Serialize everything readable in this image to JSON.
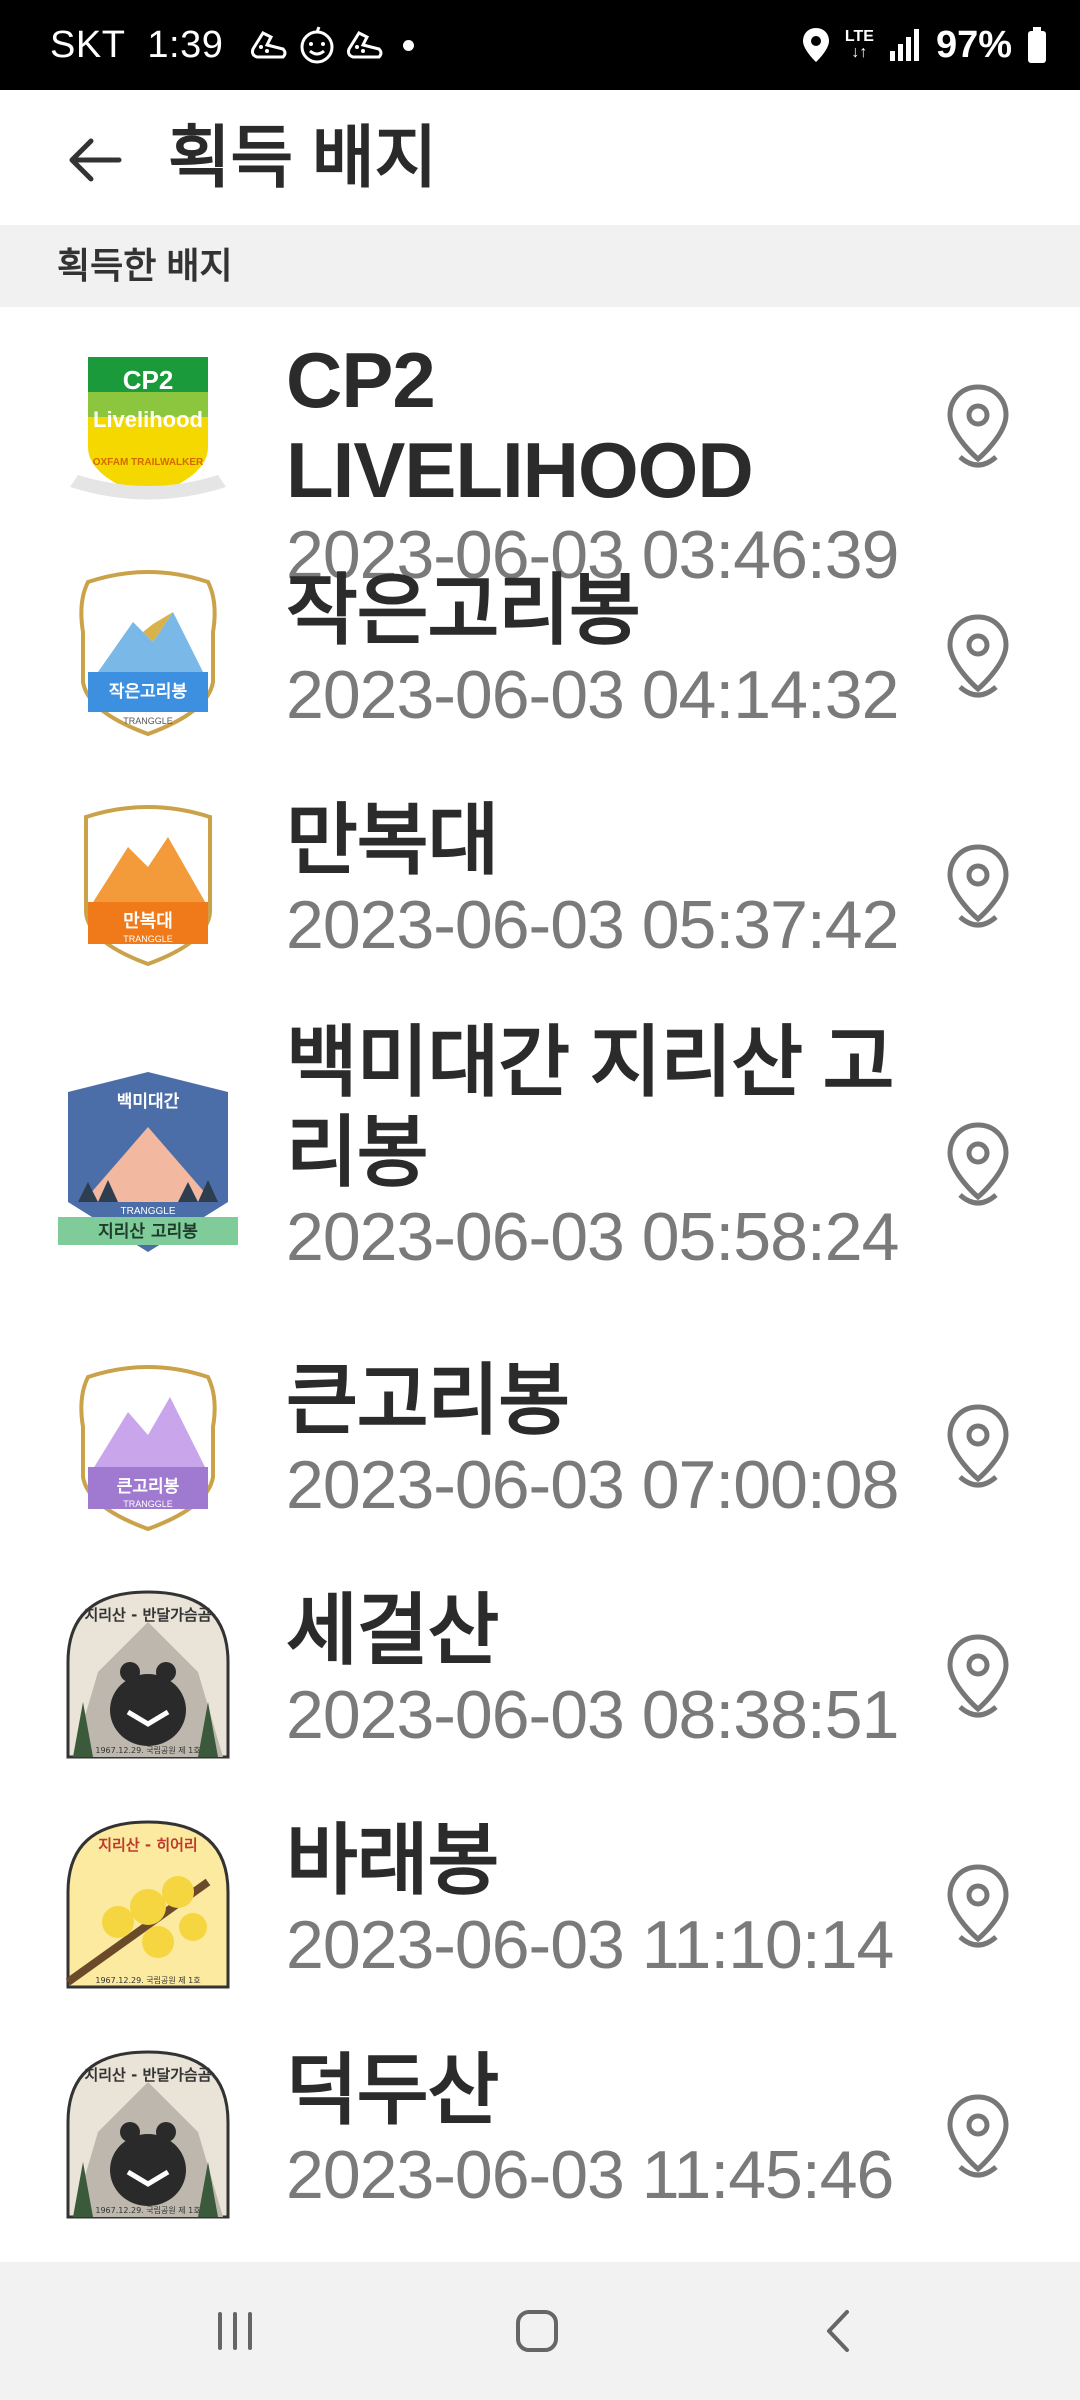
{
  "status_bar": {
    "carrier": "SKT",
    "time": "1:39",
    "network": "LTE",
    "battery": "97%",
    "icons": [
      "shoe-icon",
      "smiley-icon",
      "shoe-icon",
      "dot-icon",
      "location-icon",
      "signal-icon",
      "battery-icon"
    ]
  },
  "header": {
    "title": "획득 배지",
    "back_icon": "back-arrow-icon"
  },
  "section": {
    "label": "획득한 배지"
  },
  "badges": [
    {
      "name": "CP2 LIVELIHOOD",
      "date": "2023-06-03 03:46:39",
      "badge_line1": "CP2",
      "badge_line2": "Livelihood",
      "badge_line3": "OXFAM TRAILWALKER",
      "color": "#f2c600"
    },
    {
      "name": "작은고리봉",
      "date": "2023-06-03 04:14:32",
      "badge_label": "작은고리봉",
      "badge_sub": "TRANGGLE",
      "color": "#3d8fe0"
    },
    {
      "name": "만복대",
      "date": "2023-06-03 05:37:42",
      "badge_label": "만복대",
      "badge_sub": "TRANGGLE",
      "color": "#f07a1a"
    },
    {
      "name": "백미대간 지리산 고리봉",
      "date": "2023-06-03 05:58:24",
      "badge_top": "백미대간",
      "badge_label": "지리산 고리봉",
      "badge_sub": "TRANGGLE",
      "color": "#4b6ea8"
    },
    {
      "name": "큰고리봉",
      "date": "2023-06-03 07:00:08",
      "badge_label": "큰고리봉",
      "badge_sub": "TRANGGLE",
      "color": "#a07ad0"
    },
    {
      "name": "세걸산",
      "date": "2023-06-03 08:38:51",
      "badge_arc": "지리산 - 반달가슴곰",
      "badge_foot": "1967.12.29. 국립공원 제 1호",
      "color": "#8a8a8a"
    },
    {
      "name": "바래봉",
      "date": "2023-06-03 11:10:14",
      "badge_arc": "지리산 - 히어리",
      "badge_foot": "1967.12.29. 국립공원 제 1호",
      "color": "#f5d640"
    },
    {
      "name": "덕두산",
      "date": "2023-06-03 11:45:46",
      "badge_arc": "지리산 - 반달가슴곰",
      "badge_foot": "1967.12.29. 국립공원 제 1호",
      "color": "#8a8a8a"
    }
  ]
}
